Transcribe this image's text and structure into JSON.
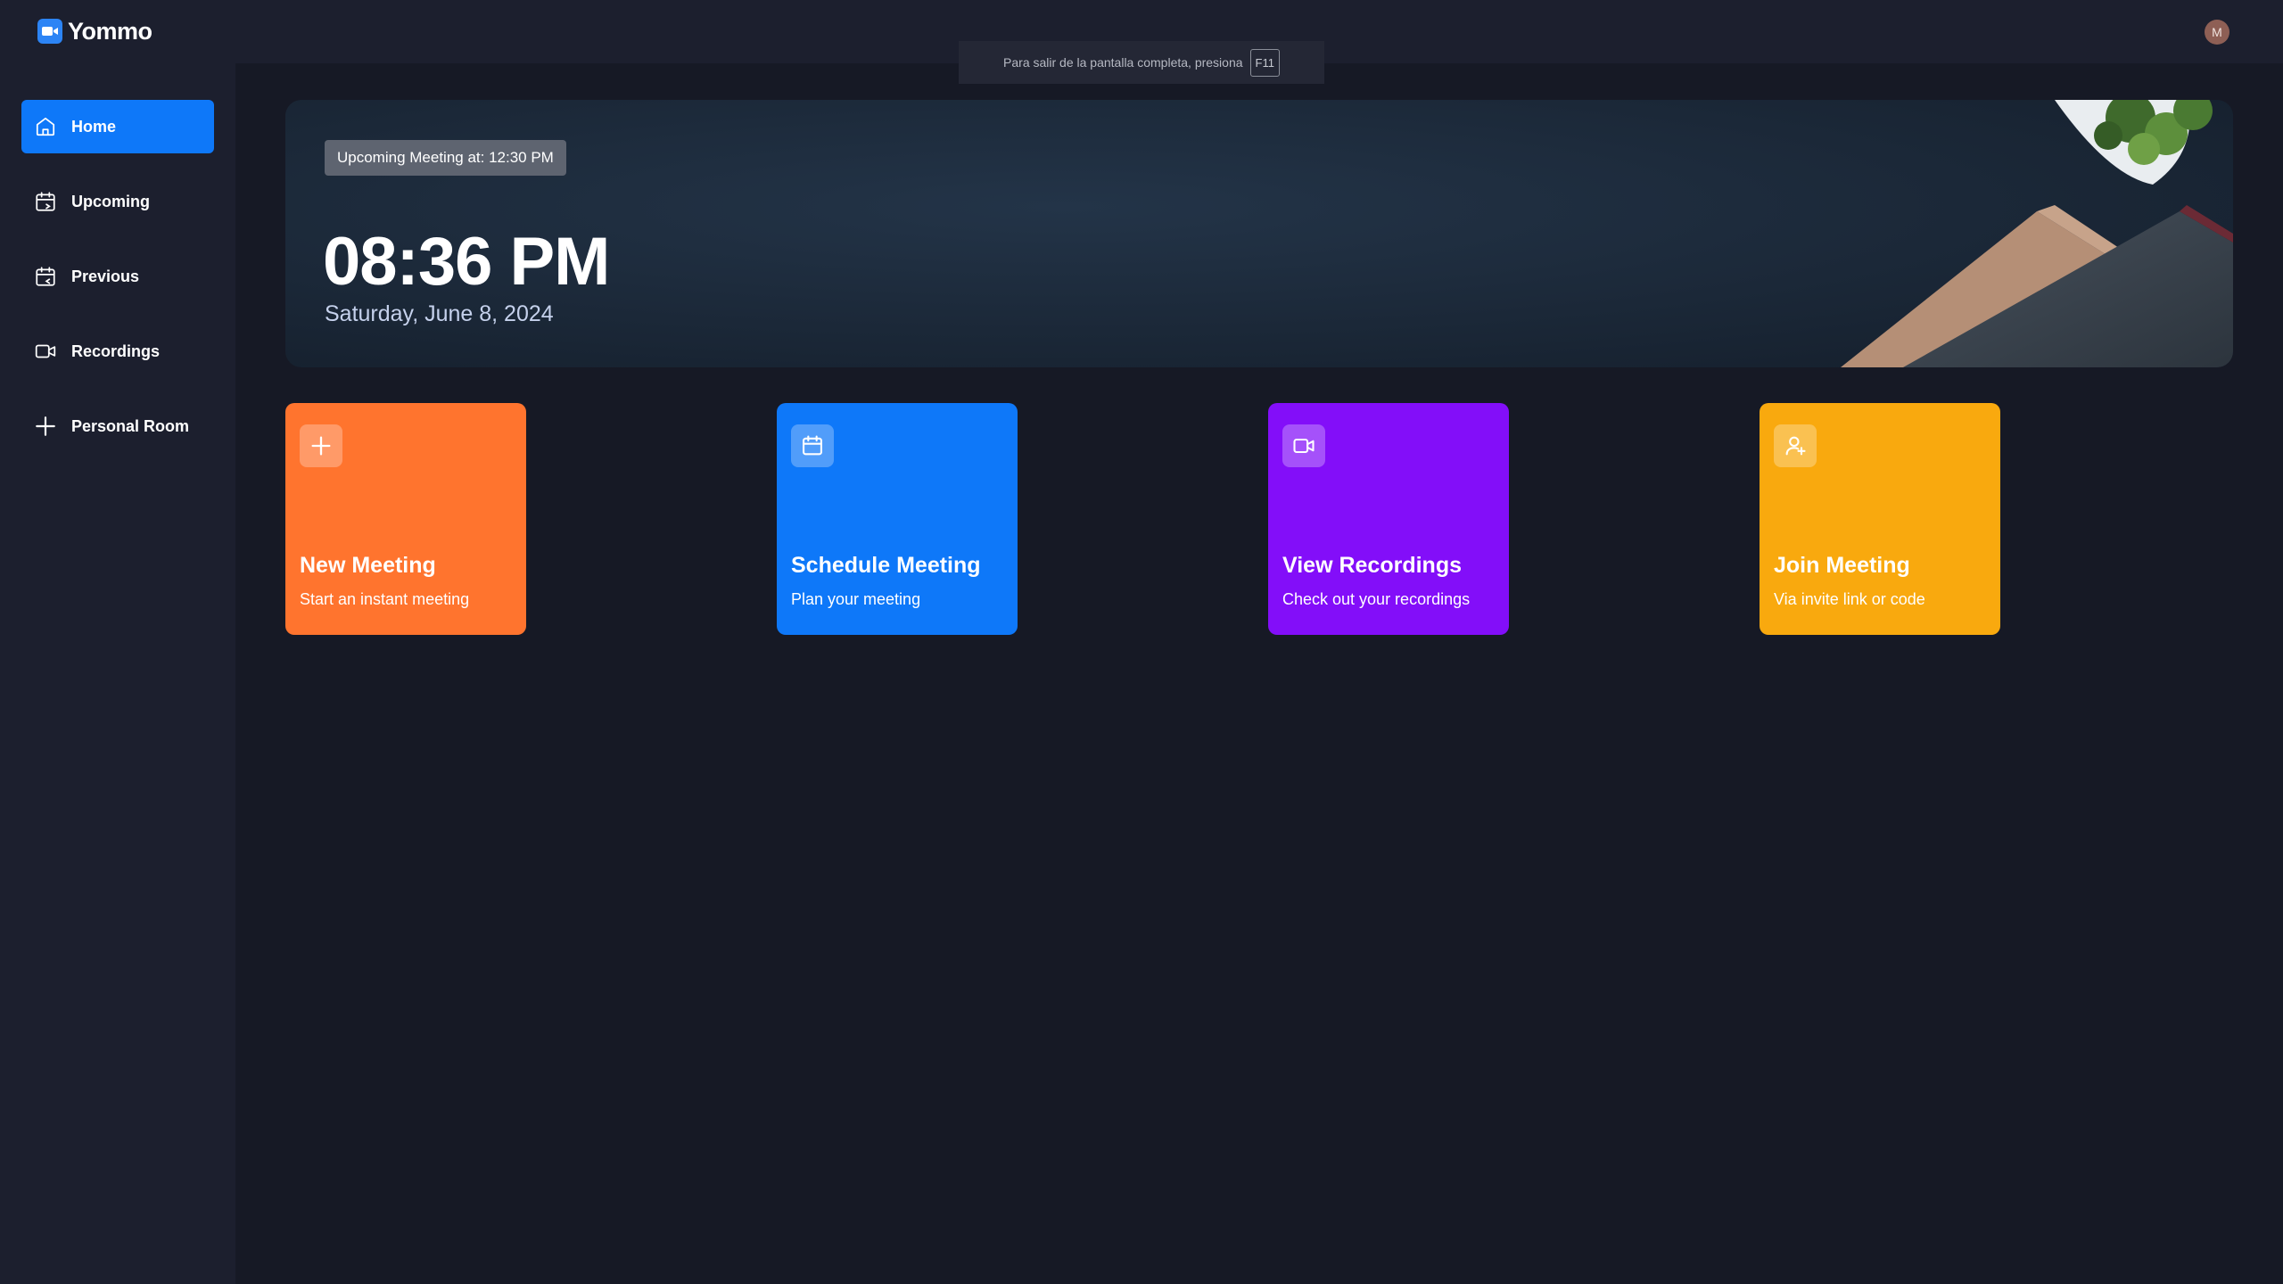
{
  "app": {
    "name": "Yommo",
    "user_initial": "M"
  },
  "fullscreen_notice": {
    "text": "Para salir de la pantalla completa, presiona",
    "key": "F11"
  },
  "sidebar": {
    "items": [
      {
        "label": "Home",
        "icon": "home-icon",
        "active": true
      },
      {
        "label": "Upcoming",
        "icon": "calendar-upcoming-icon",
        "active": false
      },
      {
        "label": "Previous",
        "icon": "calendar-previous-icon",
        "active": false
      },
      {
        "label": "Recordings",
        "icon": "video-icon",
        "active": false
      },
      {
        "label": "Personal Room",
        "icon": "plus-icon",
        "active": false
      }
    ]
  },
  "hero": {
    "upcoming": "Upcoming Meeting at: 12:30 PM",
    "time": "08:36 PM",
    "date": "Saturday, June 8, 2024"
  },
  "cards": [
    {
      "title": "New Meeting",
      "subtitle": "Start an instant meeting",
      "icon": "plus-icon",
      "color": "#ff742e"
    },
    {
      "title": "Schedule Meeting",
      "subtitle": "Plan your meeting",
      "icon": "calendar-icon",
      "color": "#0e78f9"
    },
    {
      "title": "View Recordings",
      "subtitle": "Check out your recordings",
      "icon": "video-icon",
      "color": "#830ef9"
    },
    {
      "title": "Join Meeting",
      "subtitle": "Via invite link or code",
      "icon": "user-plus-icon",
      "color": "#f9a90e"
    }
  ],
  "colors": {
    "background": "#161925",
    "panel": "#1c1f2e",
    "accent": "#0e78f9"
  }
}
